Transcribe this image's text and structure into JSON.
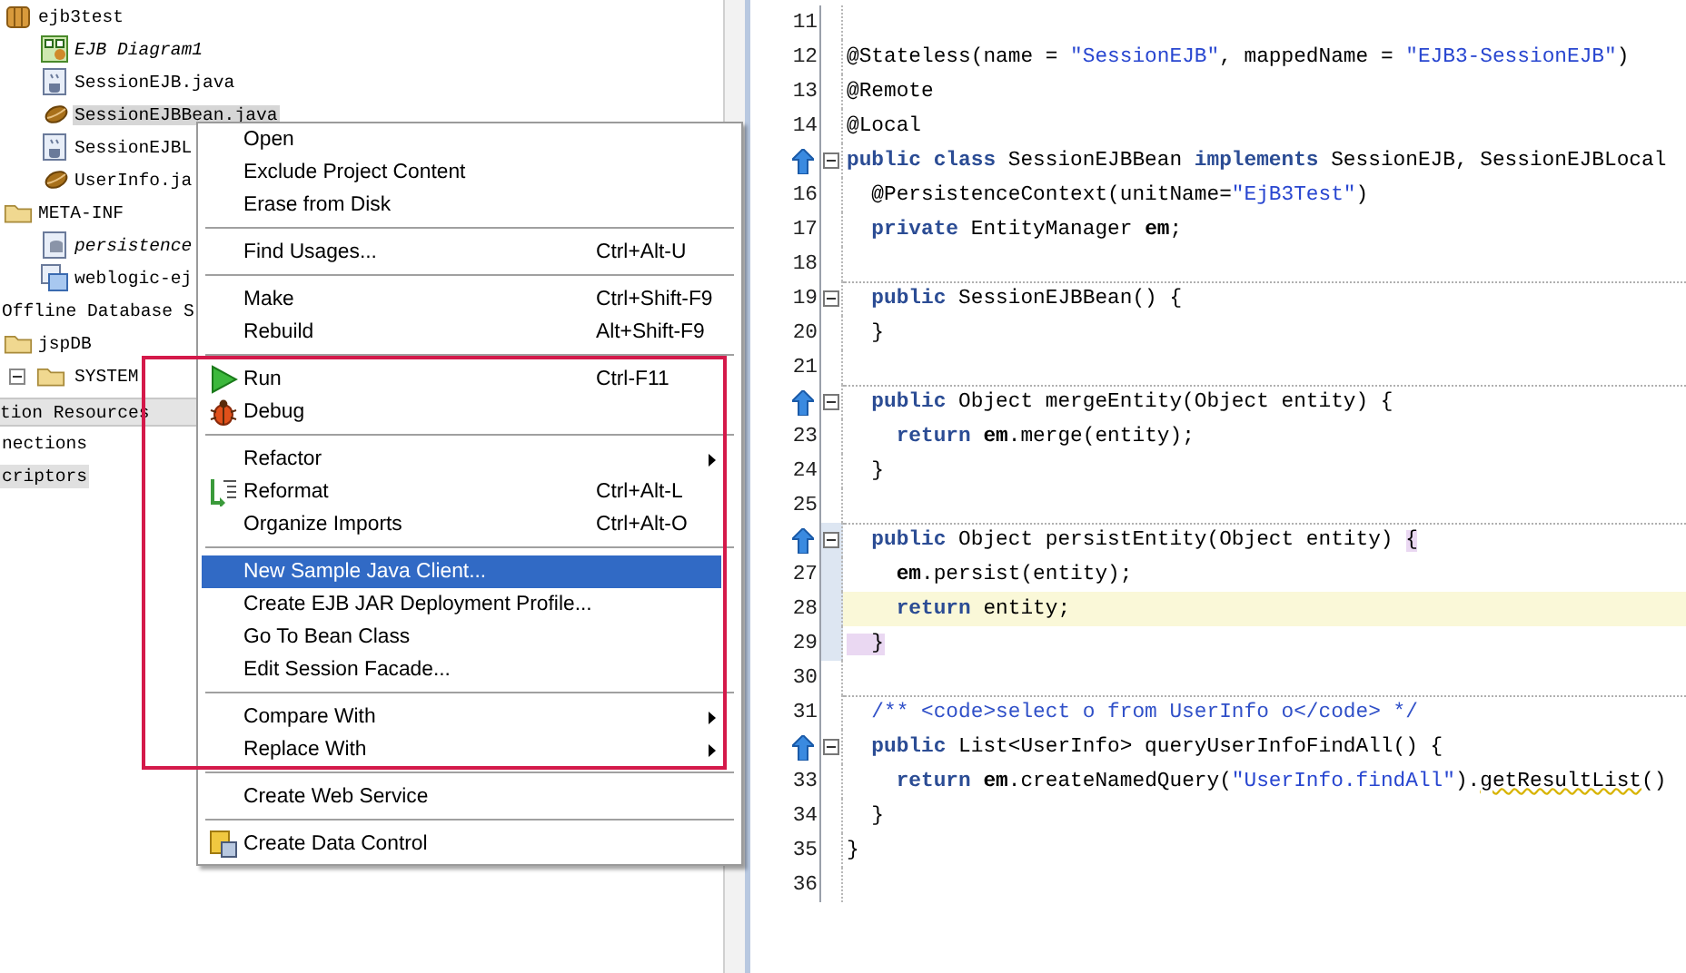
{
  "project_tree": {
    "items": [
      {
        "label": "ejb3test",
        "kind": "package",
        "selected": false,
        "italic": false,
        "children": [
          {
            "label": "EJB Diagram1",
            "kind": "diagram",
            "selected": false,
            "italic": true
          },
          {
            "label": "SessionEJB.java",
            "kind": "java",
            "selected": false,
            "italic": false
          },
          {
            "label": "SessionEJBBean.java",
            "kind": "bean",
            "selected": true,
            "italic": false
          },
          {
            "label": "SessionEJBL",
            "kind": "java",
            "selected": false,
            "italic": false
          },
          {
            "label": "UserInfo.ja",
            "kind": "bean",
            "selected": false,
            "italic": false
          }
        ]
      },
      {
        "label": "META-INF",
        "kind": "folder",
        "selected": false,
        "italic": false,
        "children": [
          {
            "label": "persistence",
            "kind": "database",
            "selected": false,
            "italic": true
          },
          {
            "label": "weblogic-ej",
            "kind": "descriptor",
            "selected": false,
            "italic": false
          }
        ]
      },
      {
        "label": "Offline Database S",
        "kind": "section",
        "selected": false,
        "italic": false,
        "children": [
          {
            "label": "jspDB",
            "kind": "folder",
            "selected": false,
            "italic": false,
            "children": [
              {
                "label": "SYSTEM",
                "kind": "folder",
                "selected": false,
                "italic": false,
                "expanded": true
              }
            ]
          }
        ]
      }
    ]
  },
  "resources": {
    "title": "tion Resources",
    "items": [
      {
        "label": "nections",
        "selected": false
      },
      {
        "label": "criptors",
        "selected": true
      }
    ]
  },
  "context_menu": {
    "items": [
      {
        "kind": "item",
        "label": "Open",
        "submenu": false,
        "selected": false
      },
      {
        "kind": "item",
        "label": "Exclude Project Content",
        "submenu": false,
        "selected": false
      },
      {
        "kind": "item",
        "label": "Erase from Disk",
        "submenu": false,
        "selected": false
      },
      {
        "kind": "separator"
      },
      {
        "kind": "item",
        "label": "Find Usages...",
        "shortcut": "Ctrl+Alt-U",
        "submenu": false,
        "selected": false
      },
      {
        "kind": "separator"
      },
      {
        "kind": "item",
        "label": "Make",
        "shortcut": "Ctrl+Shift-F9",
        "submenu": false,
        "selected": false
      },
      {
        "kind": "item",
        "label": "Rebuild",
        "shortcut": "Alt+Shift-F9",
        "submenu": false,
        "selected": false
      },
      {
        "kind": "separator"
      },
      {
        "kind": "run",
        "label": "Run",
        "shortcut": "Ctrl-F11",
        "submenu": false,
        "selected": false
      },
      {
        "kind": "debug",
        "label": "Debug",
        "submenu": false,
        "selected": false
      },
      {
        "kind": "separator"
      },
      {
        "kind": "item",
        "label": "Refactor",
        "submenu": true,
        "selected": false
      },
      {
        "kind": "reformat",
        "label": "Reformat",
        "shortcut": "Ctrl+Alt-L",
        "submenu": false,
        "selected": false
      },
      {
        "kind": "item",
        "label": "Organize Imports",
        "shortcut": "Ctrl+Alt-O",
        "submenu": false,
        "selected": false
      },
      {
        "kind": "separator"
      },
      {
        "kind": "item",
        "label": "New Sample Java Client...",
        "submenu": false,
        "selected": true
      },
      {
        "kind": "item",
        "label": "Create EJB JAR Deployment Profile...",
        "submenu": false,
        "selected": false
      },
      {
        "kind": "item",
        "label": "Go To Bean Class",
        "submenu": false,
        "selected": false
      },
      {
        "kind": "item",
        "label": "Edit Session Facade...",
        "submenu": false,
        "selected": false
      },
      {
        "kind": "separator"
      },
      {
        "kind": "item",
        "label": "Compare With",
        "submenu": true,
        "selected": false
      },
      {
        "kind": "item",
        "label": "Replace With",
        "submenu": true,
        "selected": false
      },
      {
        "kind": "separator"
      },
      {
        "kind": "item",
        "label": "Create Web Service",
        "submenu": false,
        "selected": false
      },
      {
        "kind": "separator"
      },
      {
        "kind": "data-control",
        "label": "Create Data Control",
        "submenu": false,
        "selected": false
      }
    ]
  },
  "editor": {
    "lines": [
      {
        "number": "11",
        "override": false,
        "fold": false,
        "current": false,
        "separator": false,
        "changed": false
      },
      {
        "number": "12",
        "override": false,
        "fold": false,
        "current": false,
        "separator": false,
        "changed": false,
        "tokens": [
          {
            "kind": "plain",
            "text": "@Stateless(name = "
          },
          {
            "kind": "string",
            "text": "\"SessionEJB\""
          },
          {
            "kind": "plain",
            "text": ", mappedName = "
          },
          {
            "kind": "string",
            "text": "\"EJB3-SessionEJB\""
          },
          {
            "kind": "plain",
            "text": ")"
          }
        ]
      },
      {
        "number": "13",
        "override": false,
        "fold": false,
        "current": false,
        "separator": false,
        "changed": false,
        "tokens": [
          {
            "kind": "plain",
            "text": "@Remote"
          }
        ]
      },
      {
        "number": "14",
        "override": false,
        "fold": false,
        "current": false,
        "separator": false,
        "changed": false,
        "tokens": [
          {
            "kind": "plain",
            "text": "@Local"
          }
        ]
      },
      {
        "override": true,
        "fold": true,
        "current": false,
        "separator": false,
        "changed": false,
        "tokens": [
          {
            "kind": "keyword",
            "text": "public class"
          },
          {
            "kind": "plain",
            "text": " SessionEJBBean "
          },
          {
            "kind": "keyword",
            "text": "implements"
          },
          {
            "kind": "plain",
            "text": " SessionEJB, SessionEJBLocal"
          }
        ]
      },
      {
        "number": "16",
        "override": false,
        "fold": false,
        "current": false,
        "separator": false,
        "changed": false,
        "tokens": [
          {
            "kind": "plain",
            "text": "  @PersistenceContext(unitName="
          },
          {
            "kind": "string",
            "text": "\"EjB3Test\""
          },
          {
            "kind": "plain",
            "text": ")"
          }
        ]
      },
      {
        "number": "17",
        "override": false,
        "fold": false,
        "current": false,
        "separator": false,
        "changed": false,
        "tokens": [
          {
            "kind": "keyword",
            "text": "  private"
          },
          {
            "kind": "plain",
            "text": " EntityManager "
          },
          {
            "kind": "field",
            "text": "em"
          },
          {
            "kind": "plain",
            "text": ";"
          }
        ]
      },
      {
        "number": "18",
        "override": false,
        "fold": false,
        "current": false,
        "separator": false,
        "changed": false
      },
      {
        "number": "19",
        "override": false,
        "fold": true,
        "current": false,
        "separator": true,
        "changed": false,
        "tokens": [
          {
            "kind": "keyword",
            "text": "  public"
          },
          {
            "kind": "plain",
            "text": " SessionEJBBean() {"
          }
        ]
      },
      {
        "number": "20",
        "override": false,
        "fold": false,
        "current": false,
        "separator": false,
        "changed": false,
        "tokens": [
          {
            "kind": "plain",
            "text": "  }"
          }
        ]
      },
      {
        "number": "21",
        "override": false,
        "fold": false,
        "current": false,
        "separator": false,
        "changed": false
      },
      {
        "override": true,
        "fold": true,
        "current": false,
        "separator": true,
        "changed": false,
        "tokens": [
          {
            "kind": "keyword",
            "text": "  public"
          },
          {
            "kind": "plain",
            "text": " Object mergeEntity(Object entity) {"
          }
        ]
      },
      {
        "number": "23",
        "override": false,
        "fold": false,
        "current": false,
        "separator": false,
        "changed": false,
        "tokens": [
          {
            "kind": "keyword",
            "text": "    return"
          },
          {
            "kind": "field",
            "text": " em"
          },
          {
            "kind": "plain",
            "text": ".merge(entity);"
          }
        ]
      },
      {
        "number": "24",
        "override": false,
        "fold": false,
        "current": false,
        "separator": false,
        "changed": false,
        "tokens": [
          {
            "kind": "plain",
            "text": "  }"
          }
        ]
      },
      {
        "number": "25",
        "override": false,
        "fold": false,
        "current": false,
        "separator": false,
        "changed": false
      },
      {
        "override": true,
        "fold": true,
        "current": false,
        "separator": true,
        "changed": true,
        "tokens": [
          {
            "kind": "keyword",
            "text": "  public"
          },
          {
            "kind": "plain",
            "text": " Object persistEntity(Object entity) "
          },
          {
            "kind": "match",
            "text": "{"
          }
        ]
      },
      {
        "number": "27",
        "override": false,
        "fold": false,
        "current": false,
        "separator": false,
        "changed": true,
        "tokens": [
          {
            "kind": "field",
            "text": "    em"
          },
          {
            "kind": "plain",
            "text": ".persist(entity);"
          }
        ]
      },
      {
        "number": "28",
        "override": false,
        "fold": false,
        "current": true,
        "separator": false,
        "changed": true,
        "tokens": [
          {
            "kind": "keyword",
            "text": "    return"
          },
          {
            "kind": "plain",
            "text": " entity;"
          }
        ]
      },
      {
        "number": "29",
        "override": false,
        "fold": false,
        "current": false,
        "separator": false,
        "changed": true,
        "tokens": [
          {
            "kind": "match",
            "text": "  }"
          }
        ]
      },
      {
        "number": "30",
        "override": false,
        "fold": false,
        "current": false,
        "separator": false,
        "changed": false
      },
      {
        "number": "31",
        "override": false,
        "fold": false,
        "current": false,
        "separator": true,
        "changed": false,
        "tokens": [
          {
            "kind": "comment",
            "text": "  /** <code>select o from UserInfo o</code> */"
          }
        ]
      },
      {
        "override": true,
        "fold": true,
        "current": false,
        "separator": false,
        "changed": false,
        "tokens": [
          {
            "kind": "keyword",
            "text": "  public"
          },
          {
            "kind": "plain",
            "text": " List<UserInfo> queryUserInfoFindAll() {"
          }
        ]
      },
      {
        "number": "33",
        "override": false,
        "fold": false,
        "current": false,
        "separator": false,
        "changed": false,
        "tokens": [
          {
            "kind": "keyword",
            "text": "    return"
          },
          {
            "kind": "field",
            "text": " em"
          },
          {
            "kind": "plain",
            "text": ".createNamedQuery("
          },
          {
            "kind": "string",
            "text": "\"UserInfo.findAll\""
          },
          {
            "kind": "plain",
            "text": ")."
          },
          {
            "kind": "warning",
            "text": "getResultList"
          },
          {
            "kind": "plain",
            "text": "()"
          }
        ]
      },
      {
        "number": "34",
        "override": false,
        "fold": false,
        "current": false,
        "separator": false,
        "changed": false,
        "tokens": [
          {
            "kind": "plain",
            "text": "  }"
          }
        ]
      },
      {
        "number": "35",
        "override": false,
        "fold": false,
        "current": false,
        "separator": false,
        "changed": false,
        "tokens": [
          {
            "kind": "plain",
            "text": "}"
          }
        ]
      },
      {
        "number": "36",
        "override": false,
        "fold": false,
        "current": false,
        "separator": false,
        "changed": false
      }
    ]
  }
}
